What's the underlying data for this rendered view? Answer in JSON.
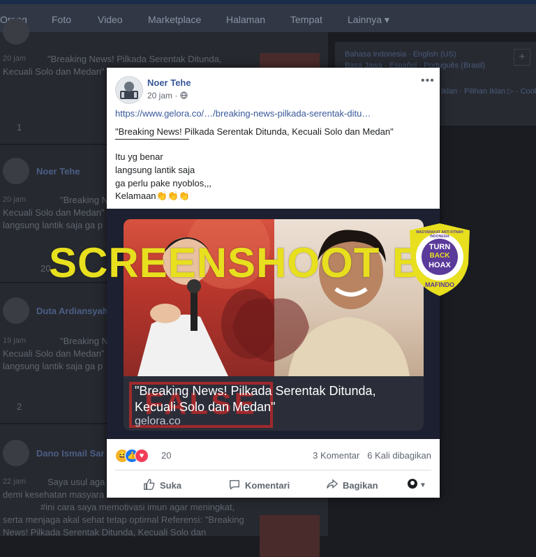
{
  "nav": {
    "items": [
      "Orang",
      "Foto",
      "Video",
      "Marketplace",
      "Halaman",
      "Tempat",
      "Lainnya ▾"
    ]
  },
  "background_feed": {
    "cards": [
      {
        "time": "20 jam",
        "text1": "\"Breaking News! Pilkada Serentak Ditunda,",
        "text2": "Kecuali Solo dan Medan\"",
        "reactions": "1"
      },
      {
        "name": "Noer Tehe",
        "time": "20 jam",
        "text1": "\"Breaking N",
        "text2": "Kecuali Solo dan Medan\"",
        "text3": "langsung lantik saja ga p",
        "reactions": "20"
      },
      {
        "name": "Duta Ardiansyah",
        "time": "19 jam",
        "text1": "\"Breaking N",
        "text2": "Kecuali Solo dan Medan\"",
        "text3": "langsung lantik saja ga p",
        "reactions": "2"
      },
      {
        "name": "Dano Ismail Sar",
        "time": "22 jam",
        "text1": "Saya usul aga",
        "text2": "demi kesehatan masyara",
        "text3": "#ini cara saya memotivasi imun agar meningkat,",
        "text4": "serta menjaga akal sehat tetap optimal Referensi: \"Breaking",
        "text5": "News! Pilkada Serentak Ditunda, Kecuali Solo dan"
      }
    ]
  },
  "right_panel": {
    "langs_row1": "Bahasa Indonesia · English (US)",
    "langs_row2": "Basa Jawa · Español · Português (Brasil)",
    "langs_row3": "Iklan · Pilihan Iklan ▷ · Cookie"
  },
  "post": {
    "author": "Noer Tehe",
    "time": "20 jam",
    "link": "https://www.gelora.co/…/breaking-news-pilkada-serentak-ditu…",
    "quote": "\"Breaking News! Pilkada Serentak Ditunda, Kecuali Solo dan Medan\"",
    "line1": "Itu yg benar",
    "line2": "langsung lantik saja",
    "line3": "ga perlu pake nyoblos,,,",
    "line4": "Kelamaan👏👏👏",
    "media": {
      "caption": "\"Breaking News! Pilkada Serentak Ditunda,",
      "caption2": "Kecuali Solo dan Medan\"",
      "source": "gelora.co",
      "stamp": "FALSE"
    },
    "reaction_count": "20",
    "comments": "3 Komentar",
    "shares": "6 Kali dibagikan",
    "actions": {
      "like": "Suka",
      "comment": "Komentari",
      "share": "Bagikan"
    }
  },
  "watermark": "SCREENSHOOT BY",
  "badge": {
    "top": "MASYARAKAT ANTI FITNAH INDONESIA",
    "line1": "TURN",
    "line2": "BACK",
    "line3": "HOAX",
    "bottom": "MAFINDO"
  }
}
